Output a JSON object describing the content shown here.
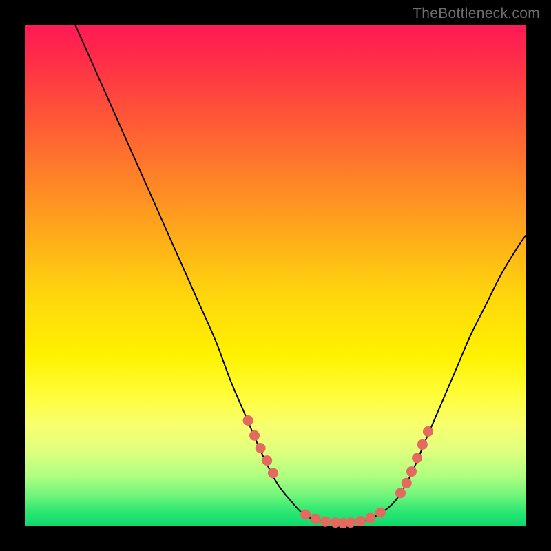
{
  "watermark": "TheBottleneck.com",
  "colors": {
    "background": "#000000",
    "curve": "#000000",
    "point": "#e4695f",
    "gradient_top": "#ff1a55",
    "gradient_bottom": "#0ed96e"
  },
  "chart_data": {
    "type": "line",
    "title": "",
    "xlabel": "",
    "ylabel": "",
    "xlim": [
      0,
      100
    ],
    "ylim": [
      0,
      100
    ],
    "curve": [
      {
        "x": 10,
        "y": 100
      },
      {
        "x": 14,
        "y": 91
      },
      {
        "x": 18,
        "y": 82
      },
      {
        "x": 22,
        "y": 73
      },
      {
        "x": 26,
        "y": 64
      },
      {
        "x": 30,
        "y": 55
      },
      {
        "x": 34,
        "y": 46
      },
      {
        "x": 38,
        "y": 37
      },
      {
        "x": 41,
        "y": 29
      },
      {
        "x": 44,
        "y": 22
      },
      {
        "x": 47,
        "y": 15
      },
      {
        "x": 50,
        "y": 9
      },
      {
        "x": 53,
        "y": 5
      },
      {
        "x": 56,
        "y": 2
      },
      {
        "x": 59,
        "y": 1
      },
      {
        "x": 62,
        "y": 0.5
      },
      {
        "x": 65,
        "y": 0.5
      },
      {
        "x": 68,
        "y": 1
      },
      {
        "x": 71,
        "y": 2.5
      },
      {
        "x": 74,
        "y": 5
      },
      {
        "x": 77,
        "y": 10
      },
      {
        "x": 80,
        "y": 17
      },
      {
        "x": 83,
        "y": 24
      },
      {
        "x": 86,
        "y": 31
      },
      {
        "x": 89,
        "y": 38
      },
      {
        "x": 92,
        "y": 44
      },
      {
        "x": 95,
        "y": 50
      },
      {
        "x": 98,
        "y": 55
      },
      {
        "x": 100,
        "y": 58
      }
    ],
    "points_left": [
      {
        "x": 44.5,
        "y": 21
      },
      {
        "x": 45.8,
        "y": 18
      },
      {
        "x": 47.0,
        "y": 15.5
      },
      {
        "x": 48.3,
        "y": 13
      },
      {
        "x": 49.5,
        "y": 10.5
      }
    ],
    "points_bottom": [
      {
        "x": 56,
        "y": 2.2
      },
      {
        "x": 58,
        "y": 1.3
      },
      {
        "x": 60,
        "y": 0.8
      },
      {
        "x": 62,
        "y": 0.6
      },
      {
        "x": 63.5,
        "y": 0.5
      },
      {
        "x": 65,
        "y": 0.6
      },
      {
        "x": 67,
        "y": 0.9
      },
      {
        "x": 69,
        "y": 1.5
      },
      {
        "x": 71,
        "y": 2.6
      }
    ],
    "points_right": [
      {
        "x": 75.0,
        "y": 6.5
      },
      {
        "x": 76.2,
        "y": 8.5
      },
      {
        "x": 77.2,
        "y": 10.8
      },
      {
        "x": 78.3,
        "y": 13.5
      },
      {
        "x": 79.4,
        "y": 16.2
      },
      {
        "x": 80.5,
        "y": 18.8
      }
    ]
  }
}
